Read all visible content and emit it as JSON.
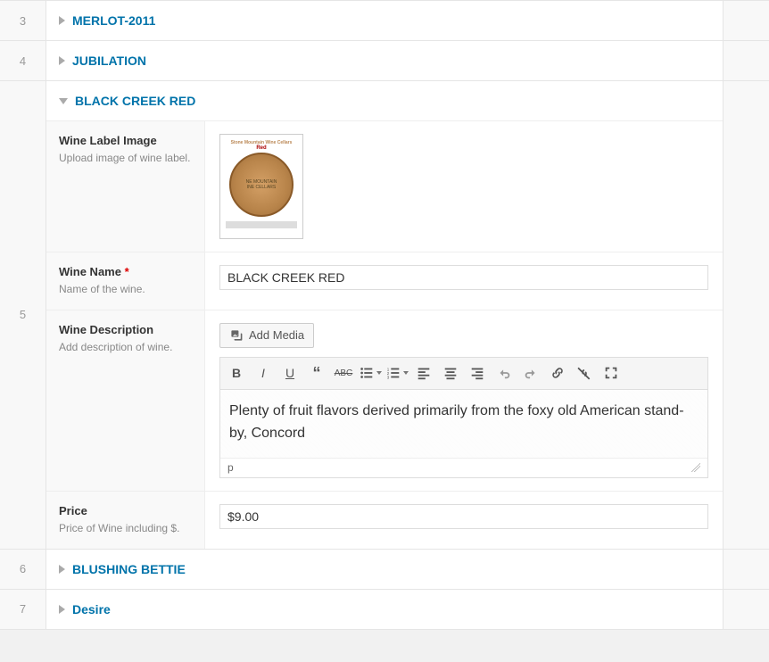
{
  "items": [
    {
      "num": "3",
      "title": "MERLOT-2011",
      "expanded": false
    },
    {
      "num": "4",
      "title": "JUBILATION",
      "expanded": false
    },
    {
      "num": "5",
      "title": "BLACK CREEK RED",
      "expanded": true
    },
    {
      "num": "6",
      "title": "BLUSHING BETTIE",
      "expanded": false
    },
    {
      "num": "7",
      "title": "Desire",
      "expanded": false
    }
  ],
  "fields": {
    "image": {
      "label": "Wine Label Image",
      "desc": "Upload image of wine label."
    },
    "name": {
      "label": "Wine Name",
      "desc": "Name of the wine.",
      "value": "BLACK CREEK RED"
    },
    "description": {
      "label": "Wine Description",
      "desc": "Add description of wine.",
      "add_media": "Add Media",
      "content": "Plenty of fruit flavors derived primarily from the foxy old American stand-by, Concord",
      "path": "p"
    },
    "price": {
      "label": "Price",
      "desc": "Price of Wine including $.",
      "value": "$9.00"
    }
  },
  "wine_image": {
    "top_text": "Stone Mountain Wine Cellars",
    "red_text": "Red",
    "circle_line1": "NE MOUNTAIN",
    "circle_line2": "INE CELLARS"
  }
}
